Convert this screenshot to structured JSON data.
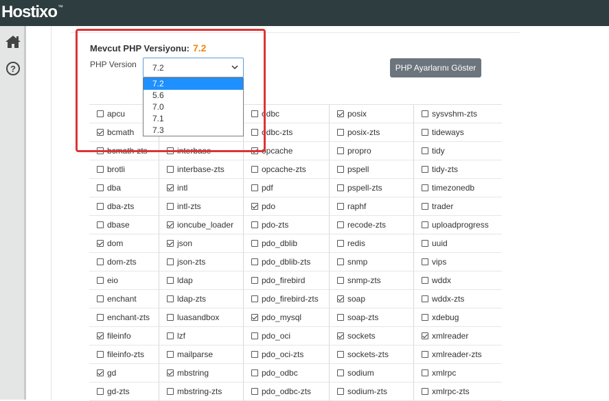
{
  "header": {
    "logo_text": "Hostixo",
    "logo_mark": "™",
    "background": "#2e3d3f"
  },
  "sidebar": {
    "items": [
      {
        "icon": "home-icon"
      },
      {
        "icon": "help-icon",
        "glyph": "?"
      }
    ]
  },
  "php": {
    "current_label": "Mevcut PHP Versiyonu:",
    "current_value": "7.2",
    "version_label": "PHP Version",
    "select_value": "7.2",
    "options": [
      "7.2",
      "5.6",
      "7.0",
      "7.1",
      "7.3"
    ],
    "selected_index": 0,
    "show_settings_label": "PHP Ayarlarını Göster"
  },
  "colors": {
    "accent_orange": "#f0870a",
    "highlight_red": "#dd3333",
    "selected_blue": "#1e90ff",
    "button_gray": "#6c757d"
  },
  "extensions": {
    "columns": [
      [
        {
          "name": "apcu",
          "checked": false
        },
        {
          "name": "bcmath",
          "checked": true
        },
        {
          "name": "bcmath-zts",
          "checked": false
        },
        {
          "name": "brotli",
          "checked": false
        },
        {
          "name": "dba",
          "checked": false
        },
        {
          "name": "dba-zts",
          "checked": false
        },
        {
          "name": "dbase",
          "checked": false
        },
        {
          "name": "dom",
          "checked": true
        },
        {
          "name": "dom-zts",
          "checked": false
        },
        {
          "name": "eio",
          "checked": false
        },
        {
          "name": "enchant",
          "checked": false
        },
        {
          "name": "enchant-zts",
          "checked": false
        },
        {
          "name": "fileinfo",
          "checked": true
        },
        {
          "name": "fileinfo-zts",
          "checked": false
        },
        {
          "name": "gd",
          "checked": true
        },
        {
          "name": "gd-zts",
          "checked": false
        }
      ],
      [
        {
          "name": "",
          "checked": false
        },
        {
          "name": "",
          "checked": false
        },
        {
          "name": "interbase",
          "checked": false
        },
        {
          "name": "interbase-zts",
          "checked": false
        },
        {
          "name": "intl",
          "checked": true
        },
        {
          "name": "intl-zts",
          "checked": false
        },
        {
          "name": "ioncube_loader",
          "checked": true
        },
        {
          "name": "json",
          "checked": true
        },
        {
          "name": "json-zts",
          "checked": false
        },
        {
          "name": "ldap",
          "checked": false
        },
        {
          "name": "ldap-zts",
          "checked": false
        },
        {
          "name": "luasandbox",
          "checked": false
        },
        {
          "name": "lzf",
          "checked": false
        },
        {
          "name": "mailparse",
          "checked": false
        },
        {
          "name": "mbstring",
          "checked": true
        },
        {
          "name": "mbstring-zts",
          "checked": false
        }
      ],
      [
        {
          "name": "odbc",
          "checked": false
        },
        {
          "name": "odbc-zts",
          "checked": false
        },
        {
          "name": "opcache",
          "checked": true
        },
        {
          "name": "opcache-zts",
          "checked": false
        },
        {
          "name": "pdf",
          "checked": false
        },
        {
          "name": "pdo",
          "checked": true
        },
        {
          "name": "pdo-zts",
          "checked": false
        },
        {
          "name": "pdo_dblib",
          "checked": false
        },
        {
          "name": "pdo_dblib-zts",
          "checked": false
        },
        {
          "name": "pdo_firebird",
          "checked": false
        },
        {
          "name": "pdo_firebird-zts",
          "checked": false
        },
        {
          "name": "pdo_mysql",
          "checked": true
        },
        {
          "name": "pdo_oci",
          "checked": false
        },
        {
          "name": "pdo_oci-zts",
          "checked": false
        },
        {
          "name": "pdo_odbc",
          "checked": false
        },
        {
          "name": "pdo_odbc-zts",
          "checked": false
        }
      ],
      [
        {
          "name": "posix",
          "checked": true
        },
        {
          "name": "posix-zts",
          "checked": false
        },
        {
          "name": "propro",
          "checked": false
        },
        {
          "name": "pspell",
          "checked": false
        },
        {
          "name": "pspell-zts",
          "checked": false
        },
        {
          "name": "raphf",
          "checked": false
        },
        {
          "name": "recode-zts",
          "checked": false
        },
        {
          "name": "redis",
          "checked": false
        },
        {
          "name": "snmp",
          "checked": false
        },
        {
          "name": "snmp-zts",
          "checked": false
        },
        {
          "name": "soap",
          "checked": true
        },
        {
          "name": "soap-zts",
          "checked": false
        },
        {
          "name": "sockets",
          "checked": true
        },
        {
          "name": "sockets-zts",
          "checked": false
        },
        {
          "name": "sodium",
          "checked": false
        },
        {
          "name": "sodium-zts",
          "checked": false
        }
      ],
      [
        {
          "name": "sysvshm-zts",
          "checked": false
        },
        {
          "name": "tideways",
          "checked": false
        },
        {
          "name": "tidy",
          "checked": false
        },
        {
          "name": "tidy-zts",
          "checked": false
        },
        {
          "name": "timezonedb",
          "checked": false
        },
        {
          "name": "trader",
          "checked": false
        },
        {
          "name": "uploadprogress",
          "checked": false
        },
        {
          "name": "uuid",
          "checked": false
        },
        {
          "name": "vips",
          "checked": false
        },
        {
          "name": "wddx",
          "checked": false
        },
        {
          "name": "wddx-zts",
          "checked": false
        },
        {
          "name": "xdebug",
          "checked": false
        },
        {
          "name": "xmlreader",
          "checked": true
        },
        {
          "name": "xmlreader-zts",
          "checked": false
        },
        {
          "name": "xmlrpc",
          "checked": false
        },
        {
          "name": "xmlrpc-zts",
          "checked": false
        }
      ]
    ]
  }
}
